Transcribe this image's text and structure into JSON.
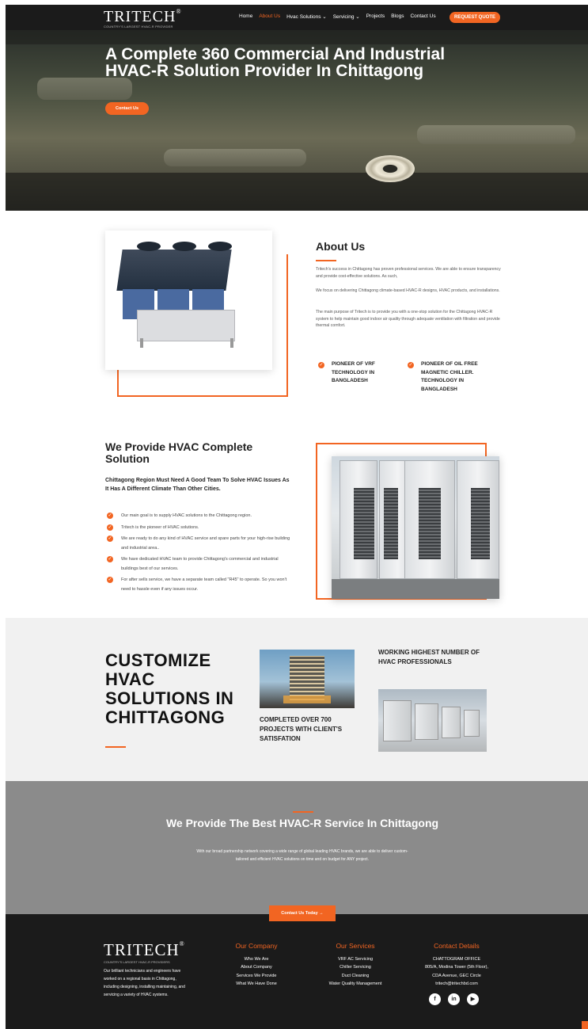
{
  "header": {
    "logo": "TRITECH",
    "logo_tagline": "COUNTRY'S LARGEST HVAC-R PROVIDER",
    "nav": [
      "Home",
      "About Us",
      "Hvac Solutions ⌄",
      "Servicing ⌄",
      "Projects",
      "Blogs",
      "Contact Us"
    ],
    "quote_button": "REQUEST QUOTE"
  },
  "hero": {
    "title": "A Complete 360 Commercial And Industrial HVAC-R Solution Provider In Chittagong",
    "button": "Contact Us"
  },
  "about": {
    "heading": "About Us",
    "paragraphs": [
      "Tritech's success in Chittagong has proven professional services. We are able to ensure transparency and provide cost-effective solutions. As such,",
      "We focus on delivering Chittagong climate-based HVAC-R designs, HVAC products, and installations.",
      "The main purpose of Tritech is to provide you with a one-stop solution for the Chittagong HVAC-R system to help maintain good indoor air quality through adequate ventilation with filtration and provide thermal comfort."
    ],
    "pioneers": [
      "PIONEER OF VRF TECHNOLOGY IN BANGLADESH",
      "PIONEER OF OIL FREE MAGNETIC CHILLER. TECHNOLOGY IN BANGLADESH"
    ]
  },
  "provide": {
    "heading": "We Provide HVAC Complete Solution",
    "subheading": "Chittagong Region Must Need A Good Team To Solve HVAC Issues As It Has A Different Climate Than Other Cities.",
    "items": [
      "Our main goal is to supply HVAC solutions to the Chittagong region.",
      "Tritech is the pioneer of HVAC solutions.",
      "We are ready to do any kind of HVAC service and spare parts for your high-rise building and industrial area..",
      "We have dedicated HVAC team to provide Chittagong's commercial and industrial buildings best of our services.",
      "For after sells service, we have a separate team called \"R45\" to operate. So you won't need to hassle even if any issues occur."
    ]
  },
  "customize": {
    "heading": "CUSTOMIZE HVAC SOLUTIONS IN CHITTAGONG",
    "stat_projects": "COMPLETED OVER 700 PROJECTS WITH CLIENT'S SATISFATION",
    "stat_professionals": "WORKING HIGHEST NUMBER OF HVAC PROFESSIONALS"
  },
  "best": {
    "heading": "We Provide The Best HVAC-R Service In Chittagong",
    "text": "With our broad partnership network covering a wide range of global leading HVAC brands, we are able to deliver custom-tailored and efficient HVAC solutions on time and on budget for ANY project.",
    "button": "Contact Us Today →"
  },
  "footer": {
    "logo": "TRITECH",
    "tagline": "COUNTRY'S LARGEST HVAC-R PROVIDERS",
    "about": "Our brilliant technicians and engineers have worked on a regional basis in Chittagong, including designing, installing maintaining, and servicing a variety of HVAC systems.",
    "company": {
      "title": "Our Company",
      "links": [
        "Who We Are",
        "About Company",
        "Services We Provide",
        "What We Have Done"
      ]
    },
    "services": {
      "title": "Our Services",
      "links": [
        "VRF AC Servicing",
        "Chiller Servicing",
        "Duct Cleaning",
        "Water Quality Management"
      ]
    },
    "contact": {
      "title": "Contact Details",
      "lines": [
        "CHATTOGRAM OFFICE",
        "805/A, Modina Tower (5th Floor),",
        "CDA Avenue, GEC Circle",
        "tritech@tritechbd.com"
      ]
    },
    "social_icons": [
      "facebook-icon",
      "linkedin-icon",
      "youtube-icon"
    ]
  },
  "colors": {
    "accent": "#f26522",
    "header_bg": "#1b1b1b",
    "band_bg": "#8b8b8b",
    "light_bg": "#f1f1f1"
  }
}
